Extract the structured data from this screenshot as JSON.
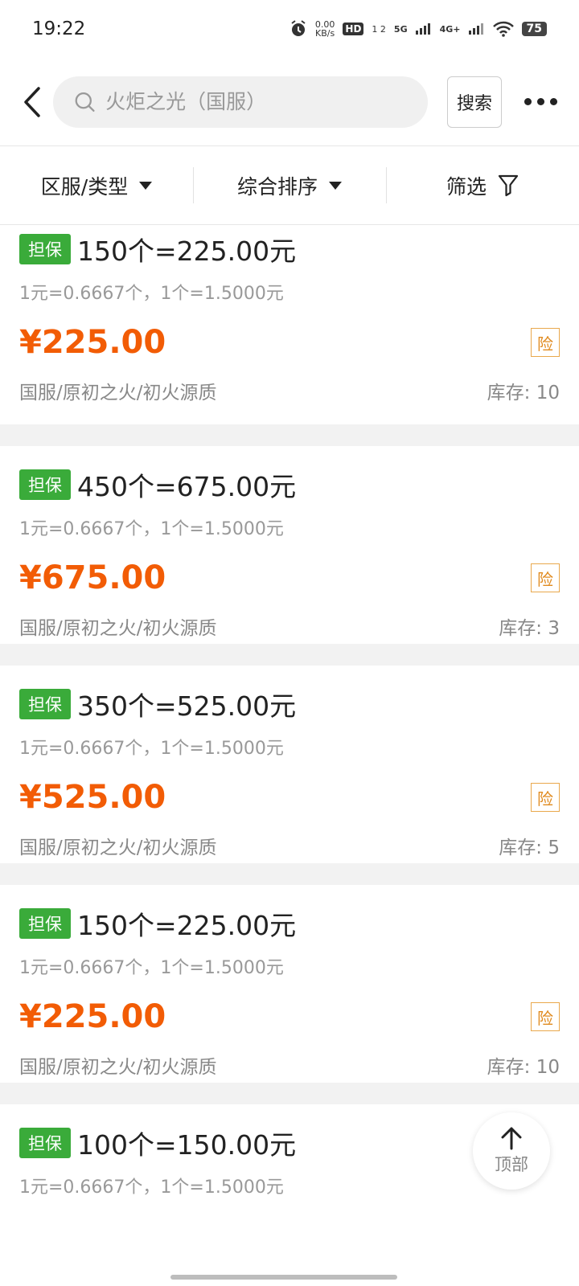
{
  "status_bar": {
    "time": "19:22",
    "net_speed": "0.00",
    "net_unit": "KB/s",
    "hd": "HD",
    "hd_sub": "1 2",
    "net1": "5G",
    "net2": "4G+",
    "battery": "75"
  },
  "header": {
    "search_placeholder": "火炬之光（国服）",
    "search_button": "搜索"
  },
  "filters": [
    {
      "label": "区服/类型"
    },
    {
      "label": "综合排序"
    },
    {
      "label": "筛选"
    }
  ],
  "listings": [
    {
      "tag": "担保",
      "title": "150个=225.00元",
      "rate": "1元=0.6667个，1个=1.5000元",
      "price": "¥225.00",
      "insurance": "险",
      "category": "国服/原初之火/初火源质",
      "stock": "库存: 10"
    },
    {
      "tag": "担保",
      "title": "450个=675.00元",
      "rate": "1元=0.6667个，1个=1.5000元",
      "price": "¥675.00",
      "insurance": "险",
      "category": "国服/原初之火/初火源质",
      "stock": "库存: 3"
    },
    {
      "tag": "担保",
      "title": "350个=525.00元",
      "rate": "1元=0.6667个，1个=1.5000元",
      "price": "¥525.00",
      "insurance": "险",
      "category": "国服/原初之火/初火源质",
      "stock": "库存: 5"
    },
    {
      "tag": "担保",
      "title": "150个=225.00元",
      "rate": "1元=0.6667个，1个=1.5000元",
      "price": "¥225.00",
      "insurance": "险",
      "category": "国服/原初之火/初火源质",
      "stock": "库存: 10"
    },
    {
      "tag": "担保",
      "title": "100个=150.00元",
      "rate": "1元=0.6667个，1个=1.5000元",
      "price": "",
      "insurance": "",
      "category": "",
      "stock": ""
    }
  ],
  "top_button": {
    "label": "顶部"
  },
  "colors": {
    "guarantee_tag": "#3aab3a",
    "price": "#f25c05",
    "insurance": "#e08a1e"
  }
}
